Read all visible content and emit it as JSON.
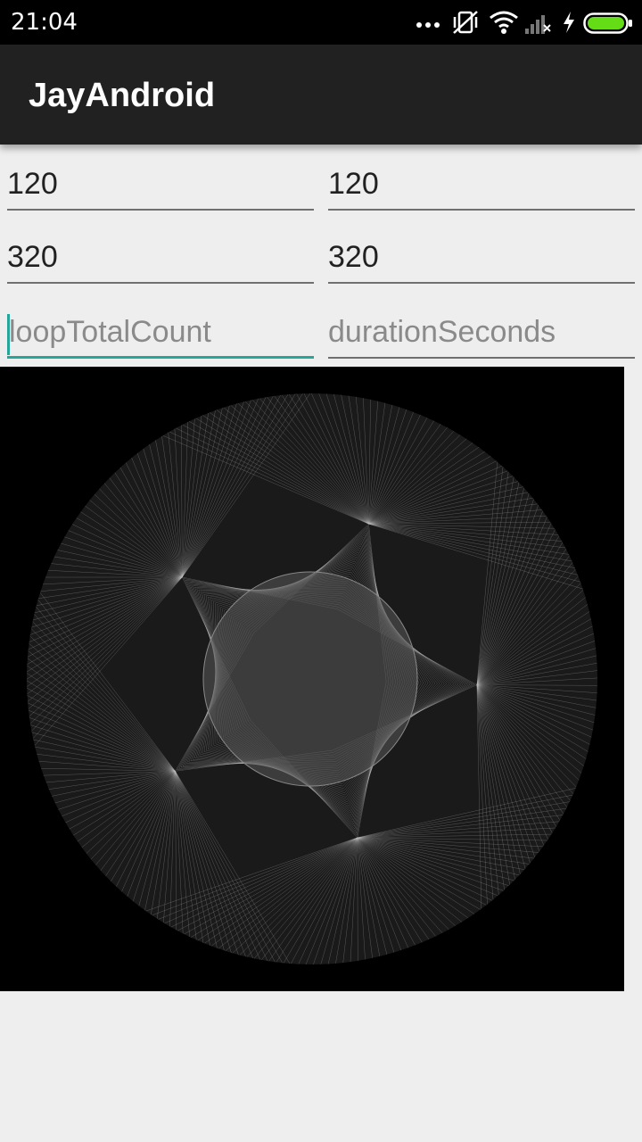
{
  "status_bar": {
    "time": "21:04",
    "icons": [
      "more-dots-icon",
      "vibrate-off-icon",
      "wifi-icon",
      "no-signal-icon",
      "charging-icon",
      "battery-icon"
    ],
    "battery_color": "#64dd17"
  },
  "app_bar": {
    "title": "JayAndroid",
    "background": "#212121"
  },
  "form": {
    "row1": {
      "left_value": "120",
      "right_value": "120"
    },
    "row2": {
      "left_value": "320",
      "right_value": "320"
    },
    "row3": {
      "left_placeholder": "loopTotalCount",
      "right_placeholder": "durationSeconds"
    },
    "focus_color": "#26a69a"
  },
  "canvas": {
    "description_icon": "spirograph-drawing",
    "background": "#000000"
  }
}
